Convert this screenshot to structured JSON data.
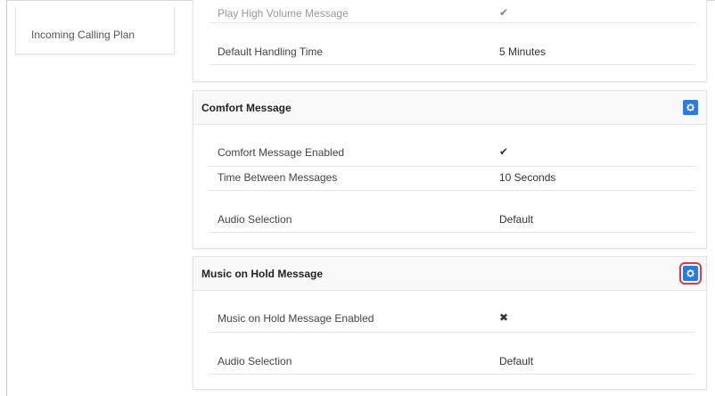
{
  "sidebar": {
    "items": [
      {
        "label": "Incoming Calling Plan"
      }
    ]
  },
  "general": {
    "rows": [
      {
        "label": "Play High Volume Message",
        "value": "✔",
        "value_kind": "check"
      },
      {
        "label": "Default Handling Time",
        "value": "5 Minutes",
        "value_kind": "text"
      }
    ]
  },
  "comfort": {
    "title": "Comfort Message",
    "settings_icon": "gear-icon",
    "rows": [
      {
        "label": "Comfort Message Enabled",
        "value": "✔",
        "value_kind": "check"
      },
      {
        "label": "Time Between Messages",
        "value": "10 Seconds",
        "value_kind": "text"
      },
      {
        "label": "Audio Selection",
        "value": "Default",
        "value_kind": "text"
      }
    ]
  },
  "music": {
    "title": "Music on Hold Message",
    "settings_icon": "gear-icon",
    "rows": [
      {
        "label": "Music on Hold Message Enabled",
        "value": "✖",
        "value_kind": "cross"
      },
      {
        "label": "Audio Selection",
        "value": "Default",
        "value_kind": "text"
      }
    ]
  },
  "colors": {
    "accent": "#2c7be5",
    "check": "#2eb85c",
    "highlight": "#e0393e"
  }
}
